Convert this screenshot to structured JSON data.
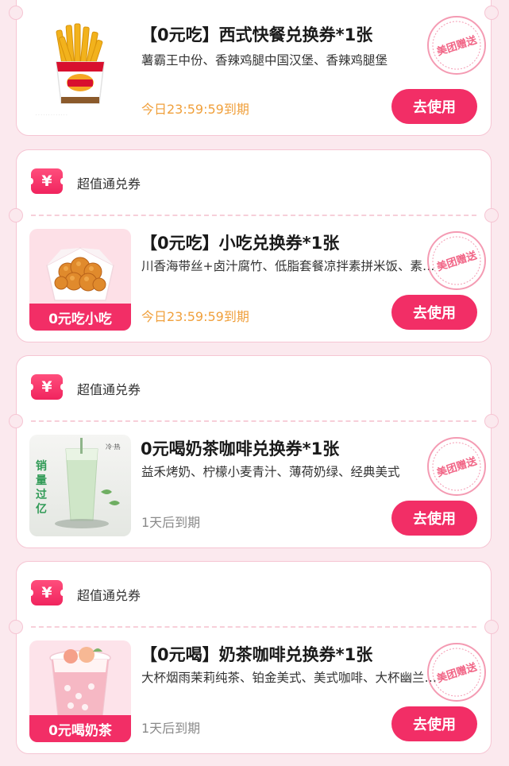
{
  "colors": {
    "accent": "#f22e66",
    "expiry_today": "#f0a03c",
    "expiry_later": "#8a8a8a",
    "page_bg": "#fbe9ee"
  },
  "coupons": [
    {
      "has_header": false,
      "title": "【0元吃】西式快餐兑换券*1张",
      "desc": "薯霸王中份、香辣鸡腿中国汉堡、香辣鸡腿堡",
      "expiry": "今日23:59:59到期",
      "expiry_style": "today",
      "button": "去使用",
      "stamp": "美团赠送",
      "thumb_icon": "fries-icon"
    },
    {
      "has_header": true,
      "header_icon": "yen-ticket-icon",
      "header_label": "超值通兑券",
      "title": "【0元吃】小吃兑换券*1张",
      "desc": "川香海带丝+卤汁腐竹、低脂套餐凉拌素拼米饭、素…",
      "expiry": "今日23:59:59到期",
      "expiry_style": "today",
      "button": "去使用",
      "stamp": "美团赠送",
      "thumb_icon": "fried-chicken-icon",
      "thumb_badge": "0元吃小吃"
    },
    {
      "has_header": true,
      "header_icon": "yen-ticket-icon",
      "header_label": "超值通兑券",
      "title": "0元喝奶茶咖啡兑换券*1张",
      "desc": "益禾烤奶、柠檬小麦青汁、薄荷奶绿、经典美式",
      "expiry": "1天后到期",
      "expiry_style": "later",
      "button": "去使用",
      "stamp": "美团赠送",
      "thumb_icon": "green-milk-tea-icon",
      "thumb_side_text": "销量过亿",
      "thumb_corner_text": "冷·热"
    },
    {
      "has_header": true,
      "header_icon": "yen-ticket-icon",
      "header_label": "超值通兑券",
      "title": "【0元喝】奶茶咖啡兑换券*1张",
      "desc": "大杯烟雨茉莉纯茶、铂金美式、美式咖啡、大杯幽兰…",
      "expiry": "1天后到期",
      "expiry_style": "later",
      "button": "去使用",
      "stamp": "美团赠送",
      "thumb_icon": "peach-milk-tea-icon",
      "thumb_badge": "0元喝奶茶"
    }
  ]
}
